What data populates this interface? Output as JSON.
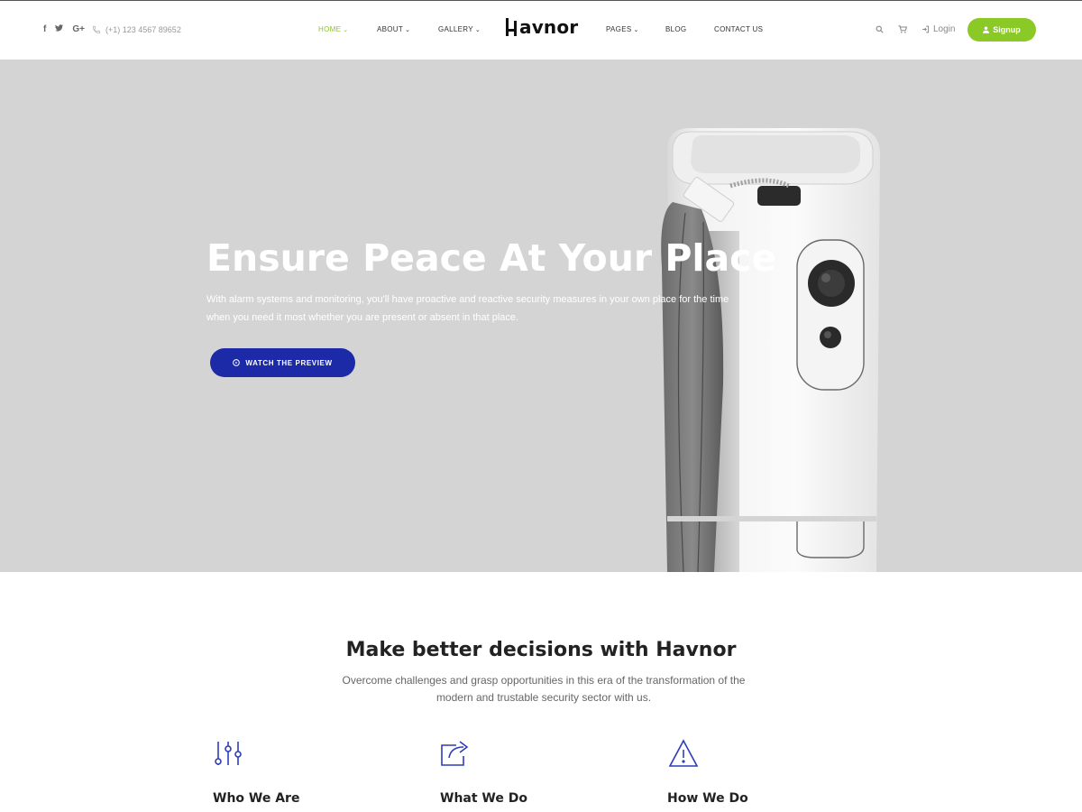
{
  "header": {
    "social": [
      {
        "icon": "facebook-icon",
        "glyph": "f"
      },
      {
        "icon": "twitter-icon",
        "glyph": "t"
      },
      {
        "icon": "google-plus-icon",
        "glyph": "G+"
      }
    ],
    "phone": "(+1) 123 4567 89652",
    "logo": "avnor",
    "logo_full": "Havnor",
    "nav": [
      {
        "label": "HOME",
        "chevron": "⌄",
        "active": true
      },
      {
        "label": "ABOUT",
        "chevron": "⌄",
        "active": false
      },
      {
        "label": "GALLERY",
        "chevron": "⌄",
        "active": false
      },
      {
        "label": "PAGES",
        "chevron": "⌄",
        "active": false
      },
      {
        "label": "BLOG",
        "chevron": "",
        "active": false
      },
      {
        "label": "CONTACT US",
        "chevron": "",
        "active": false
      }
    ],
    "login_label": "Login",
    "signup_label": "Signup"
  },
  "hero": {
    "title": "Ensure Peace At Your Place",
    "subtitle": "With alarm systems and monitoring, you'll have proactive and reactive security measures in your own place for the time when you need it most whether you are present or absent in that place.",
    "button_label": "WATCH THE PREVIEW"
  },
  "section": {
    "title": "Make better decisions with Havnor",
    "description": "Overcome challenges and grasp opportunities in this era of the transformation of the modern and trustable security sector with us.",
    "features": [
      {
        "title": "Who We Are",
        "icon": "sliders-icon"
      },
      {
        "title": "What We Do",
        "icon": "share-icon"
      },
      {
        "title": "How We Do",
        "icon": "warning-icon"
      }
    ]
  },
  "colors": {
    "accent": "#8ac926",
    "button_blue": "#1c2aa8",
    "hero_bg": "#d4d4d4",
    "icon_blue": "#2e3db8"
  }
}
